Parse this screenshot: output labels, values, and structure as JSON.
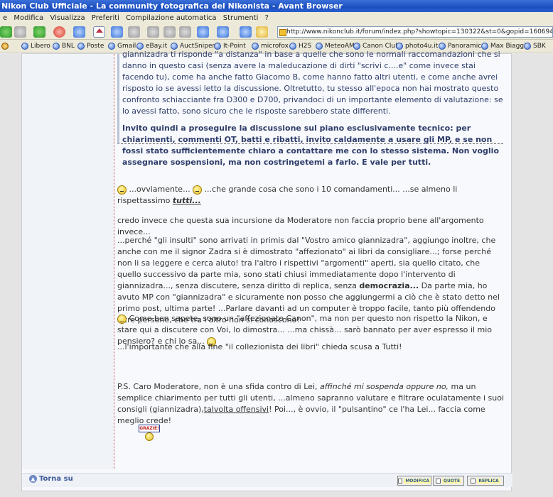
{
  "window": {
    "title": "Nikon Club Ufficiale - La community fotografica del Nikonista - Avant Browser"
  },
  "menu": [
    "e",
    "Modifica",
    "Visualizza",
    "Preferiti",
    "Compilazione automatica",
    "Strumenti",
    "?"
  ],
  "toolbar": {
    "address": "http://www.nikonclub.it/forum/index.php?showtopic=130322&st=0&gopid=1606949&#entry1606949"
  },
  "links": [
    "Libero",
    "BNL",
    "Poste",
    "Gmail",
    "eBay.it",
    "AuctSniper",
    "It-Point",
    "microfox",
    "H2S",
    "MeteoAM",
    "Canon Club",
    "photo4u.it",
    "Panoramic",
    "Max Biaggi",
    "SBK"
  ],
  "quote": {
    "p1": "giannizadra ti risponde \"a distanza\" in base a quelle che sono le normali raccomandazioni che si danno in questo casi (senza avere la maleducazione di dirti \"scrivi c....e\" come invece stai facendo tu), come ha anche fatto Giacomo B, come hanno fatto altri utenti, e come anche avrei risposto io se avessi letto la discussione. Oltretutto, tu stesso all'epoca non hai mostrato questo confronto schiacciante fra D300 e D700, privandoci di un importante elemento di valutazione: se lo avessi fatto, sono sicuro che le risposte sarebbero state differenti.",
    "p2": "Invito quindi a proseguire la discussione sul piano esclusivamente tecnico: per chiarimenti, commenti OT, batti e ribatti, invito caldamente a usare gli MP, e se non fossi stato sufficientemente chiaro a contattare me con lo stesso sistema. Non voglio assegnare sospensioni, ma non costringetemi a farlo. E vale per tutti."
  },
  "post": {
    "line1_a": "...ovviamente...",
    "line1_b": "...che grande cosa che sono i 10 comandamenti... ...se almeno li rispettassimo",
    "line1_c": "tutti...",
    "para2": "credo invece che questa sua incursione da Moderatore non faccia proprio bene all'argomento invece...",
    "para3": "...perché \"gli insulti\" sono arrivati in primis dal \"Vostro amico giannizadra\", aggiungo inoltre, che anche con me il signor Zadra si è dimostrato \"affezionato\" ai libri da consigliare...; forse perché non li sa leggere e cerca aiuto! tra l'altro i rispettivi \"argomenti\" aperti, sia quello citato, che quello successivo da parte mia, sono stati chiusi immediatamente dopo l'intervento di giannizadra..., senza discutere, senza diritto di replica, senza",
    "para3_bold": "democrazia...",
    "para3_b": "Da parte mia, ho avuto MP con \"giannizadra\" e sicuramente non posso che aggiungermi a ciò che è stato detto nel primo post, ultima parte! ...Parlare davanti ad un computer è troppo facile, tanto più offendendo altre persone, che tra l'altro non si conoscono!",
    "para4": "Come ben sapete, sono un \"affezionato Canon\", ma non per questo non rispetto la Nikon, e stare qui a discutere con Voi, lo dimostra... ...ma chissà... sarò bannato per aver espresso il mio pensiero? e chi lo sa...",
    "para5": "...l'importante che alla fine \"il collezionista dei libri\" chieda scusa a Tutti!",
    "ps_a": "P.S. Caro Moderatore, non è una sfida contro di Lei,",
    "ps_italic": "affinché mi sospenda oppure no,",
    "ps_b": "ma un semplice chiarimento per tutti gli utenti, ...almeno sapranno valutare e filtrare oculatamente i suoi consigli (giannizadra),",
    "ps_underline": "talvolta offensivi",
    "ps_c": "! Poi..., è ovvio, il \"pulsantino\" ce l'ha Lei... faccia come meglio crede!",
    "grazie": "GRAZIE!"
  },
  "footer": {
    "torna_su": "Torna su",
    "modifica": "MODIFICA",
    "quote": "QUOTE",
    "replica": "REPLICA"
  }
}
